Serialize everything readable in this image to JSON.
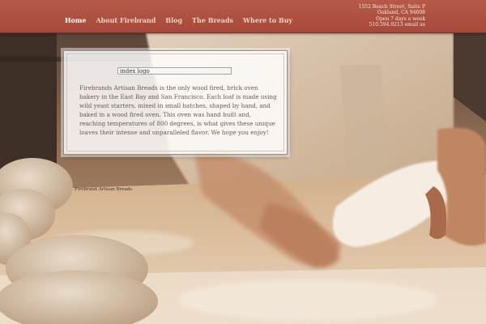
{
  "nav": {
    "items": [
      {
        "label": "Home",
        "active": true
      },
      {
        "label": "About Firebrand",
        "active": false
      },
      {
        "label": "Blog",
        "active": false
      },
      {
        "label": "The Breads",
        "active": false
      },
      {
        "label": "Where to Buy",
        "active": false
      }
    ]
  },
  "contact": {
    "address_line1": "1552 Beach Street, Suite P",
    "address_line2": "Oakland, CA 94608",
    "hours": "Open 7 days a week",
    "phone_email": "510.594.9213 email us"
  },
  "panel": {
    "logo_alt": "index logo",
    "intro": "Firebrands Artisan Breads is the only wood fired, brick oven bakery in the East Bay and San Francisco. Each loaf is made using wild yeast starters, mixed in small batches, shaped by hand, and baked in a wood fired oven. This oven was hand built and, reaching temperatures of 800 degrees, is what gives these unique loaves their intense and unparalleled flavor. We hope you enjoy!"
  },
  "photo": {
    "caption": "Firebrand Artisan Breads"
  },
  "colors": {
    "header": "#a6493a",
    "nav_text": "#f0d2c0",
    "panel_text": "#6a5a4f"
  }
}
